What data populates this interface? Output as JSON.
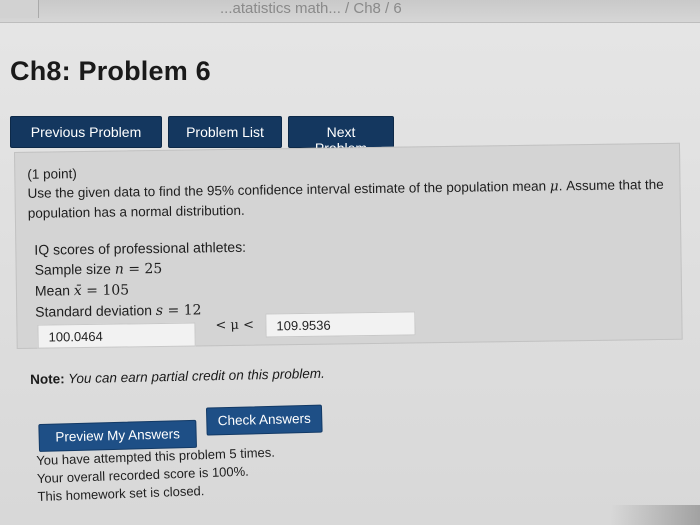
{
  "header": {
    "breadcrumb": "...atatistics math... / Ch8 / 6"
  },
  "page_title": "Ch8: Problem 6",
  "nav": {
    "previous_label": "Previous Problem",
    "list_label": "Problem List",
    "next_label": "Next Problem"
  },
  "problem": {
    "points": "(1 point)",
    "instruction_part1": "Use the given data to find the 95% confidence interval estimate of the population mean ",
    "mu_symbol": "μ",
    "instruction_part2": ". Assume that the population has a normal distribution.",
    "data_title": "IQ scores of professional athletes:",
    "sample_size_label": "Sample size ",
    "sample_size_var": "n",
    "sample_size_eq": " = 25",
    "mean_label": "Mean ",
    "mean_var": "x̄",
    "mean_eq": " = 105",
    "sd_label": "Standard deviation ",
    "sd_var": "s",
    "sd_eq": " = 12",
    "lower_value": "100.0464",
    "between_text": "< μ <",
    "upper_value": "109.9536"
  },
  "note": {
    "label": "Note:",
    "message": " You can earn partial credit on this problem."
  },
  "actions": {
    "preview_label": "Preview My Answers",
    "check_label": "Check Answers"
  },
  "status": {
    "attempts": "You have attempted this problem 5 times.",
    "score": "Your overall recorded score is 100%.",
    "closed": "This homework set is closed."
  }
}
